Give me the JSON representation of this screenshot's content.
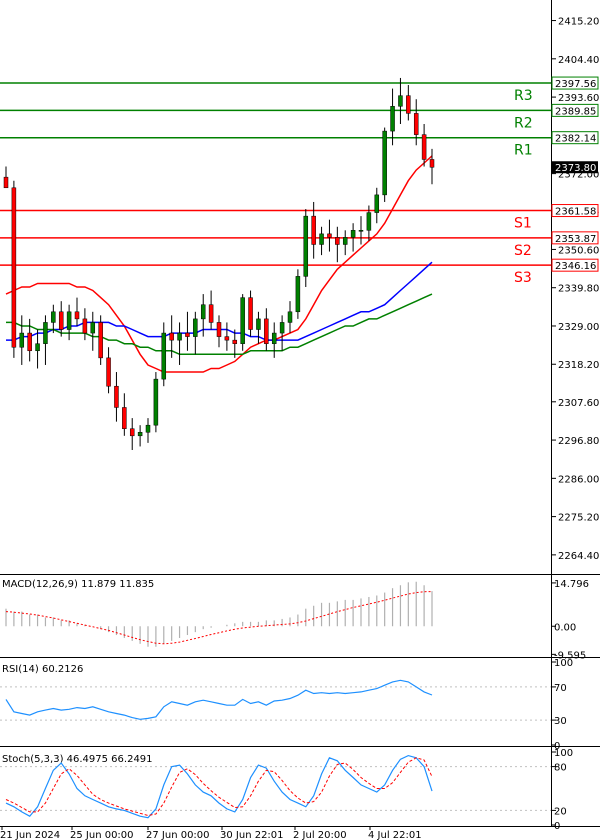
{
  "chart_data": {
    "type": "candlestick",
    "price_axis": {
      "ticks": [
        "2415.20",
        "2404.40",
        "2393.60",
        "2372.00",
        "2361.58",
        "2350.60",
        "2339.80",
        "2329.00",
        "2318.20",
        "2307.60",
        "2296.80",
        "2286.00",
        "2275.20",
        "2264.40"
      ],
      "ylim": [
        2259.0,
        2421.0
      ]
    },
    "current_price": "2373.80",
    "levels": [
      {
        "name": "R3",
        "value": 2397.56,
        "label": "2397.56",
        "color": "#008000"
      },
      {
        "name": "R2",
        "value": 2389.85,
        "label": "2389.85",
        "color": "#008000"
      },
      {
        "name": "R1",
        "value": 2382.14,
        "label": "2382.14",
        "color": "#008000"
      },
      {
        "name": "S1",
        "value": 2361.58,
        "label": "2361.58",
        "color": "#ff0000"
      },
      {
        "name": "S2",
        "value": 2353.87,
        "label": "2353.87",
        "color": "#ff0000"
      },
      {
        "name": "S3",
        "value": 2346.16,
        "label": "2346.16",
        "color": "#ff0000"
      }
    ],
    "x_labels": [
      "21 Jun 2024",
      "25 Jun 00:00",
      "27 Jun 00:00",
      "30 Jun 22:01",
      "2 Jul 20:00",
      "4 Jul 22:01"
    ],
    "candles": [
      [
        2371,
        2374,
        2368,
        2368
      ],
      [
        2368,
        2370,
        2320,
        2323
      ],
      [
        2323,
        2332,
        2318,
        2327
      ],
      [
        2327,
        2331,
        2319,
        2322
      ],
      [
        2322,
        2328,
        2317,
        2324
      ],
      [
        2324,
        2332,
        2318,
        2330
      ],
      [
        2330,
        2335,
        2327,
        2333
      ],
      [
        2333,
        2336,
        2326,
        2328
      ],
      [
        2328,
        2335,
        2325,
        2333
      ],
      [
        2333,
        2337,
        2329,
        2331
      ],
      [
        2331,
        2334,
        2325,
        2327
      ],
      [
        2327,
        2333,
        2322,
        2330
      ],
      [
        2330,
        2332,
        2318,
        2320
      ],
      [
        2320,
        2323,
        2310,
        2312
      ],
      [
        2312,
        2316,
        2302,
        2306
      ],
      [
        2306,
        2310,
        2298,
        2300
      ],
      [
        2300,
        2303,
        2294,
        2298
      ],
      [
        2298,
        2301,
        2295,
        2299
      ],
      [
        2299,
        2303,
        2296,
        2301
      ],
      [
        2301,
        2316,
        2299,
        2314
      ],
      [
        2314,
        2330,
        2312,
        2327
      ],
      [
        2327,
        2332,
        2320,
        2325
      ],
      [
        2325,
        2330,
        2318,
        2327
      ],
      [
        2327,
        2333,
        2322,
        2326
      ],
      [
        2326,
        2333,
        2321,
        2331
      ],
      [
        2331,
        2338,
        2326,
        2335
      ],
      [
        2335,
        2339,
        2328,
        2330
      ],
      [
        2330,
        2332,
        2323,
        2326
      ],
      [
        2326,
        2330,
        2322,
        2325
      ],
      [
        2325,
        2328,
        2320,
        2324
      ],
      [
        2324,
        2338,
        2322,
        2337
      ],
      [
        2337,
        2339,
        2326,
        2328
      ],
      [
        2328,
        2333,
        2324,
        2331
      ],
      [
        2331,
        2334,
        2322,
        2324
      ],
      [
        2324,
        2330,
        2320,
        2327
      ],
      [
        2327,
        2332,
        2322,
        2330
      ],
      [
        2330,
        2336,
        2327,
        2333
      ],
      [
        2333,
        2345,
        2331,
        2343
      ],
      [
        2343,
        2362,
        2340,
        2360
      ],
      [
        2360,
        2364,
        2348,
        2352
      ],
      [
        2352,
        2357,
        2349,
        2355
      ],
      [
        2355,
        2359,
        2350,
        2354
      ],
      [
        2354,
        2357,
        2347,
        2352
      ],
      [
        2352,
        2356,
        2349,
        2354
      ],
      [
        2354,
        2358,
        2350,
        2356
      ],
      [
        2356,
        2360,
        2352,
        2356
      ],
      [
        2356,
        2363,
        2353,
        2361
      ],
      [
        2361,
        2368,
        2358,
        2366
      ],
      [
        2366,
        2385,
        2364,
        2384
      ],
      [
        2384,
        2396,
        2380,
        2391
      ],
      [
        2391,
        2399,
        2386,
        2394
      ],
      [
        2394,
        2397,
        2387,
        2389
      ],
      [
        2389,
        2393,
        2380,
        2383
      ],
      [
        2383,
        2386,
        2374,
        2376
      ],
      [
        2376,
        2379,
        2369,
        2373.8
      ]
    ],
    "ma_series": [
      {
        "color": "#ff0000",
        "values": [
          2338,
          2339,
          2340,
          2340,
          2341,
          2341,
          2341,
          2341,
          2341,
          2340,
          2340,
          2339,
          2337,
          2335,
          2332,
          2329,
          2325,
          2321,
          2318,
          2317,
          2316,
          2316,
          2316,
          2316,
          2316,
          2316,
          2317,
          2317,
          2318,
          2319,
          2321,
          2323,
          2324,
          2325,
          2325,
          2326,
          2327,
          2328,
          2331,
          2335,
          2339,
          2342,
          2345,
          2347,
          2349,
          2351,
          2353,
          2355,
          2358,
          2362,
          2366,
          2370,
          2373,
          2375,
          2377
        ]
      },
      {
        "color": "#0000ff",
        "values": [
          2325,
          2325,
          2326,
          2326,
          2327,
          2327,
          2328,
          2328,
          2329,
          2329,
          2330,
          2330,
          2330,
          2330,
          2329,
          2329,
          2328,
          2327,
          2326,
          2326,
          2326,
          2327,
          2327,
          2327,
          2327,
          2328,
          2328,
          2328,
          2328,
          2327,
          2327,
          2326,
          2326,
          2325,
          2325,
          2325,
          2325,
          2325,
          2326,
          2327,
          2328,
          2329,
          2330,
          2331,
          2332,
          2333,
          2333,
          2334,
          2335,
          2337,
          2339,
          2341,
          2343,
          2345,
          2347
        ]
      },
      {
        "color": "#008000",
        "values": [
          2330,
          2330,
          2329,
          2329,
          2328,
          2328,
          2328,
          2327,
          2327,
          2327,
          2327,
          2326,
          2326,
          2325,
          2325,
          2324,
          2324,
          2323,
          2323,
          2322,
          2322,
          2322,
          2321,
          2321,
          2321,
          2321,
          2321,
          2321,
          2321,
          2321,
          2321,
          2322,
          2322,
          2322,
          2322,
          2322,
          2323,
          2323,
          2324,
          2325,
          2326,
          2327,
          2328,
          2329,
          2329,
          2330,
          2331,
          2331,
          2332,
          2333,
          2334,
          2335,
          2336,
          2337,
          2338
        ]
      }
    ],
    "macd": {
      "label": "MACD(12,26,9) 11.879 11.835",
      "ticks": [
        "14.796",
        "0.00",
        "-9.595"
      ],
      "ylim": [
        -10.5,
        17.5
      ],
      "hist": [
        6,
        5,
        5,
        4,
        4,
        3,
        3,
        2,
        2,
        1,
        0.5,
        0,
        -1,
        -2,
        -3,
        -4,
        -5,
        -6,
        -7,
        -7,
        -6,
        -5,
        -4,
        -3,
        -2,
        -1,
        -0.5,
        0,
        0.5,
        1,
        1.5,
        1.5,
        1.5,
        2,
        2,
        2.5,
        3,
        4,
        6,
        7,
        8,
        8,
        8.5,
        9,
        9,
        9.5,
        10,
        10.5,
        11.5,
        13,
        14,
        15,
        15.2,
        14,
        12
      ],
      "signal": [
        5,
        4.8,
        4.5,
        4.2,
        3.8,
        3.3,
        2.8,
        2.2,
        1.6,
        1,
        0.4,
        -0.2,
        -0.8,
        -1.4,
        -2.2,
        -3,
        -3.8,
        -4.6,
        -5.2,
        -5.8,
        -6,
        -5.8,
        -5.4,
        -4.8,
        -4.2,
        -3.5,
        -2.8,
        -2.2,
        -1.6,
        -1,
        -0.6,
        -0.3,
        0,
        0.2,
        0.4,
        0.6,
        0.8,
        1.2,
        1.8,
        2.6,
        3.4,
        4.2,
        5,
        5.7,
        6.4,
        7,
        7.6,
        8.2,
        8.9,
        9.6,
        10.3,
        11,
        11.5,
        11.8,
        11.835
      ]
    },
    "rsi": {
      "label": "RSI(14) 60.2126",
      "ticks": [
        "100",
        "70",
        "30",
        "0"
      ],
      "ylim": [
        0,
        100
      ],
      "values": [
        55,
        40,
        38,
        36,
        40,
        42,
        44,
        42,
        43,
        45,
        44,
        46,
        43,
        40,
        38,
        36,
        33,
        31,
        32,
        34,
        46,
        52,
        50,
        48,
        52,
        54,
        52,
        50,
        48,
        48,
        55,
        50,
        52,
        48,
        53,
        54,
        56,
        60,
        66,
        62,
        63,
        62,
        63,
        62,
        63,
        64,
        66,
        68,
        72,
        76,
        78,
        76,
        70,
        64,
        60.2126
      ]
    },
    "stoch": {
      "label": "Stoch(5,3,3) 46.4975 66.2491",
      "ticks": [
        "100",
        "80",
        "20",
        "0"
      ],
      "ylim": [
        0,
        100
      ],
      "k": [
        30,
        25,
        18,
        12,
        25,
        50,
        75,
        85,
        70,
        50,
        40,
        35,
        30,
        25,
        22,
        20,
        16,
        12,
        10,
        22,
        55,
        80,
        82,
        70,
        55,
        45,
        40,
        30,
        22,
        18,
        35,
        65,
        82,
        78,
        60,
        45,
        35,
        30,
        25,
        40,
        70,
        92,
        88,
        75,
        65,
        55,
        50,
        45,
        55,
        75,
        90,
        95,
        92,
        80,
        46.4975
      ],
      "d": [
        35,
        30,
        24,
        18,
        18,
        30,
        50,
        70,
        77,
        68,
        55,
        42,
        35,
        30,
        26,
        22,
        19,
        16,
        13,
        15,
        30,
        52,
        72,
        77,
        69,
        57,
        47,
        38,
        31,
        24,
        25,
        40,
        60,
        75,
        73,
        61,
        47,
        37,
        30,
        32,
        45,
        67,
        83,
        85,
        76,
        65,
        57,
        50,
        50,
        58,
        72,
        86,
        92,
        89,
        66.2491
      ]
    }
  }
}
